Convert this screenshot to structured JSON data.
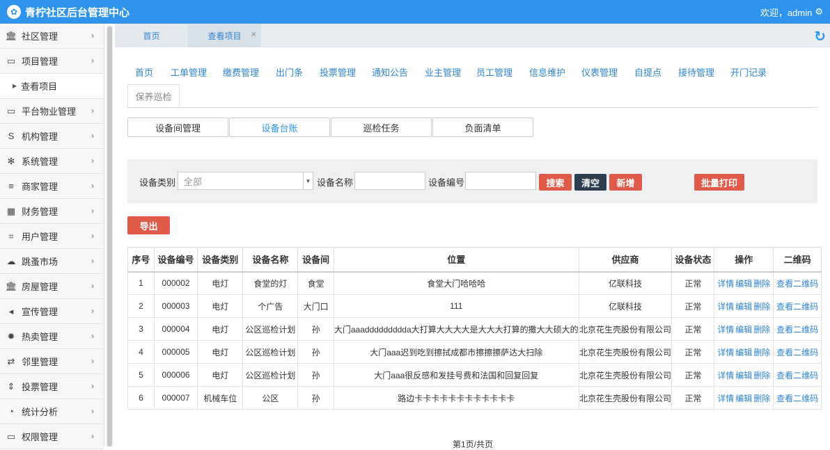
{
  "app": {
    "title": "青柠社区后台管理中心",
    "logo_icon": "leaf-logo-icon",
    "welcome": "欢迎，admin"
  },
  "sidebar": {
    "items": [
      {
        "label": "社区管理",
        "icon": "bank-icon"
      },
      {
        "label": "项目管理",
        "icon": "discover-card-icon"
      },
      {
        "label": "平台物业管理",
        "icon": "monitor-icon"
      },
      {
        "label": "机构管理",
        "icon": "stripe-icon"
      },
      {
        "label": "系统管理",
        "icon": "yelp-icon"
      },
      {
        "label": "商家管理",
        "icon": "bars-icon"
      },
      {
        "label": "财务管理",
        "icon": "calculator-icon"
      },
      {
        "label": "用户管理",
        "icon": "crop-icon"
      },
      {
        "label": "跳蚤市场",
        "icon": "cloud-icon"
      },
      {
        "label": "房屋管理",
        "icon": "building-icon"
      },
      {
        "label": "宣传管理",
        "icon": "volume-icon"
      },
      {
        "label": "热卖管理",
        "icon": "sun-icon"
      },
      {
        "label": "邻里管理",
        "icon": "retweet-icon"
      },
      {
        "label": "投票管理",
        "icon": "sort-icon"
      },
      {
        "label": "统计分析",
        "icon": "pie-chart-icon"
      },
      {
        "label": "权限管理",
        "icon": "window-icon"
      }
    ],
    "sub_item": "查看项目"
  },
  "tabs": {
    "home": "首页",
    "current": "查看项目"
  },
  "module_nav": [
    "首页",
    "工单管理",
    "缴费管理",
    "出门条",
    "投票管理",
    "通知公告",
    "业主管理",
    "员工管理",
    "信息维护",
    "仪表管理",
    "自提点",
    "接待管理",
    "开门记录"
  ],
  "module_tab": "保养巡检",
  "sub_tabs": [
    "设备间管理",
    "设备台账",
    "巡检任务",
    "负面清单"
  ],
  "filter": {
    "type_label": "设备类别",
    "type_value": "全部",
    "name_label": "设备名称",
    "code_label": "设备编号",
    "search": "搜索",
    "clear": "清空",
    "add": "新增",
    "batch_print": "批量打印"
  },
  "export_label": "导出",
  "table": {
    "headers": [
      "序号",
      "设备编号",
      "设备类别",
      "设备名称",
      "设备间",
      "位置",
      "供应商",
      "设备状态",
      "操作",
      "二维码"
    ],
    "ops": [
      "详情",
      "编辑",
      "删除"
    ],
    "qr": "查看二维码",
    "rows": [
      [
        "1",
        "000002",
        "电灯",
        "食堂的灯",
        "食堂",
        "食堂大门哈哈哈",
        "亿联科技",
        "正常"
      ],
      [
        "2",
        "000003",
        "电灯",
        "个广告",
        "大门口",
        "111",
        "亿联科技",
        "正常"
      ],
      [
        "3",
        "000004",
        "电灯",
        "公区巡检计划",
        "孙",
        "大门aaaddddddddda大打算大大大大是大大大打算的撒大大硕大的",
        "北京花生壳股份有限公司",
        "正常"
      ],
      [
        "4",
        "000005",
        "电灯",
        "公区巡检计划",
        "孙",
        "大门aaa迟到吃到擦拭成都市擦擦擦萨达大扫除",
        "北京花生壳股份有限公司",
        "正常"
      ],
      [
        "5",
        "000006",
        "电灯",
        "公区巡检计划",
        "孙",
        "大门aaa很反感和发挂号费和法国和回复回复",
        "北京花生壳股份有限公司",
        "正常"
      ],
      [
        "6",
        "000007",
        "机械车位",
        "公区",
        "孙",
        "路边卡卡卡卡卡卡卡卡卡卡卡卡",
        "北京花生壳股份有限公司",
        "正常"
      ]
    ]
  },
  "pager": "第1页/共页"
}
